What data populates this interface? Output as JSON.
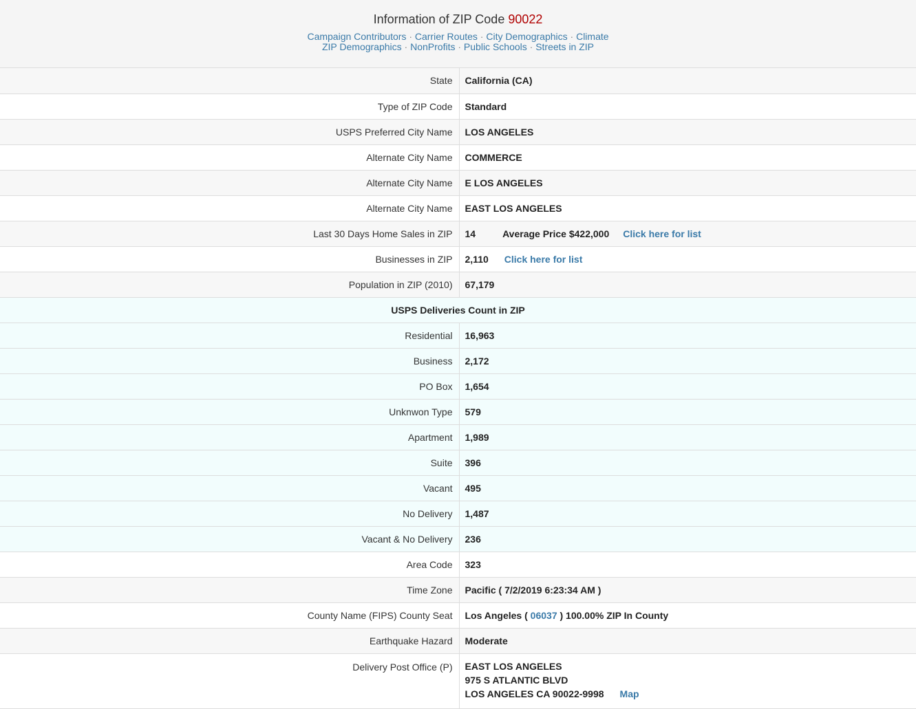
{
  "header": {
    "title_prefix": "Information of ZIP Code",
    "zip": "90022",
    "links_row1": [
      "Campaign Contributors",
      "Carrier Routes",
      "City Demographics",
      "Climate"
    ],
    "links_row2": [
      "ZIP Demographics",
      "NonProfits",
      "Public Schools",
      "Streets in ZIP"
    ],
    "separator": "·"
  },
  "rows": {
    "state": {
      "label": "State",
      "value": "California (CA)"
    },
    "zip_type": {
      "label": "Type of ZIP Code",
      "value": "Standard"
    },
    "preferred_city": {
      "label": "USPS Preferred City Name",
      "value": "LOS ANGELES"
    },
    "alt_city_1": {
      "label": "Alternate City Name",
      "value": "COMMERCE"
    },
    "alt_city_2": {
      "label": "Alternate City Name",
      "value": "E LOS ANGELES"
    },
    "alt_city_3": {
      "label": "Alternate City Name",
      "value": "EAST LOS ANGELES"
    },
    "home_sales": {
      "label": "Last 30 Days Home Sales in ZIP",
      "value": "14",
      "avg_price": "Average Price $422,000",
      "link": "Click here for list"
    },
    "businesses": {
      "label": "Businesses in ZIP",
      "value": "2,110",
      "link": "Click here for list"
    },
    "population": {
      "label": "Population in ZIP (2010)",
      "value": "67,179"
    }
  },
  "deliveries": {
    "heading": "USPS Deliveries Count in ZIP",
    "items": [
      {
        "label": "Residential",
        "value": "16,963"
      },
      {
        "label": "Business",
        "value": "2,172"
      },
      {
        "label": "PO Box",
        "value": "1,654"
      },
      {
        "label": "Unknwon Type",
        "value": "579"
      },
      {
        "label": "Apartment",
        "value": "1,989"
      },
      {
        "label": "Suite",
        "value": "396"
      },
      {
        "label": "Vacant",
        "value": "495"
      },
      {
        "label": "No Delivery",
        "value": "1,487"
      },
      {
        "label": "Vacant & No Delivery",
        "value": "236"
      }
    ]
  },
  "more": {
    "area_code": {
      "label": "Area Code",
      "value": "323"
    },
    "time_zone": {
      "label": "Time Zone",
      "value": "Pacific ( 7/2/2019 6:23:34 AM )"
    },
    "county": {
      "label": "County Name (FIPS) County Seat",
      "name": "Los Angeles (",
      "fips": "06037",
      "suffix": ") 100.00% ZIP In County"
    },
    "earthquake": {
      "label": "Earthquake Hazard",
      "value": "Moderate"
    },
    "post_office": {
      "label": "Delivery Post Office (P)",
      "line1": "EAST LOS ANGELES",
      "line2": "975 S ATLANTIC BLVD",
      "line3": "LOS ANGELES CA 90022-9998",
      "map_link": "Map"
    }
  }
}
